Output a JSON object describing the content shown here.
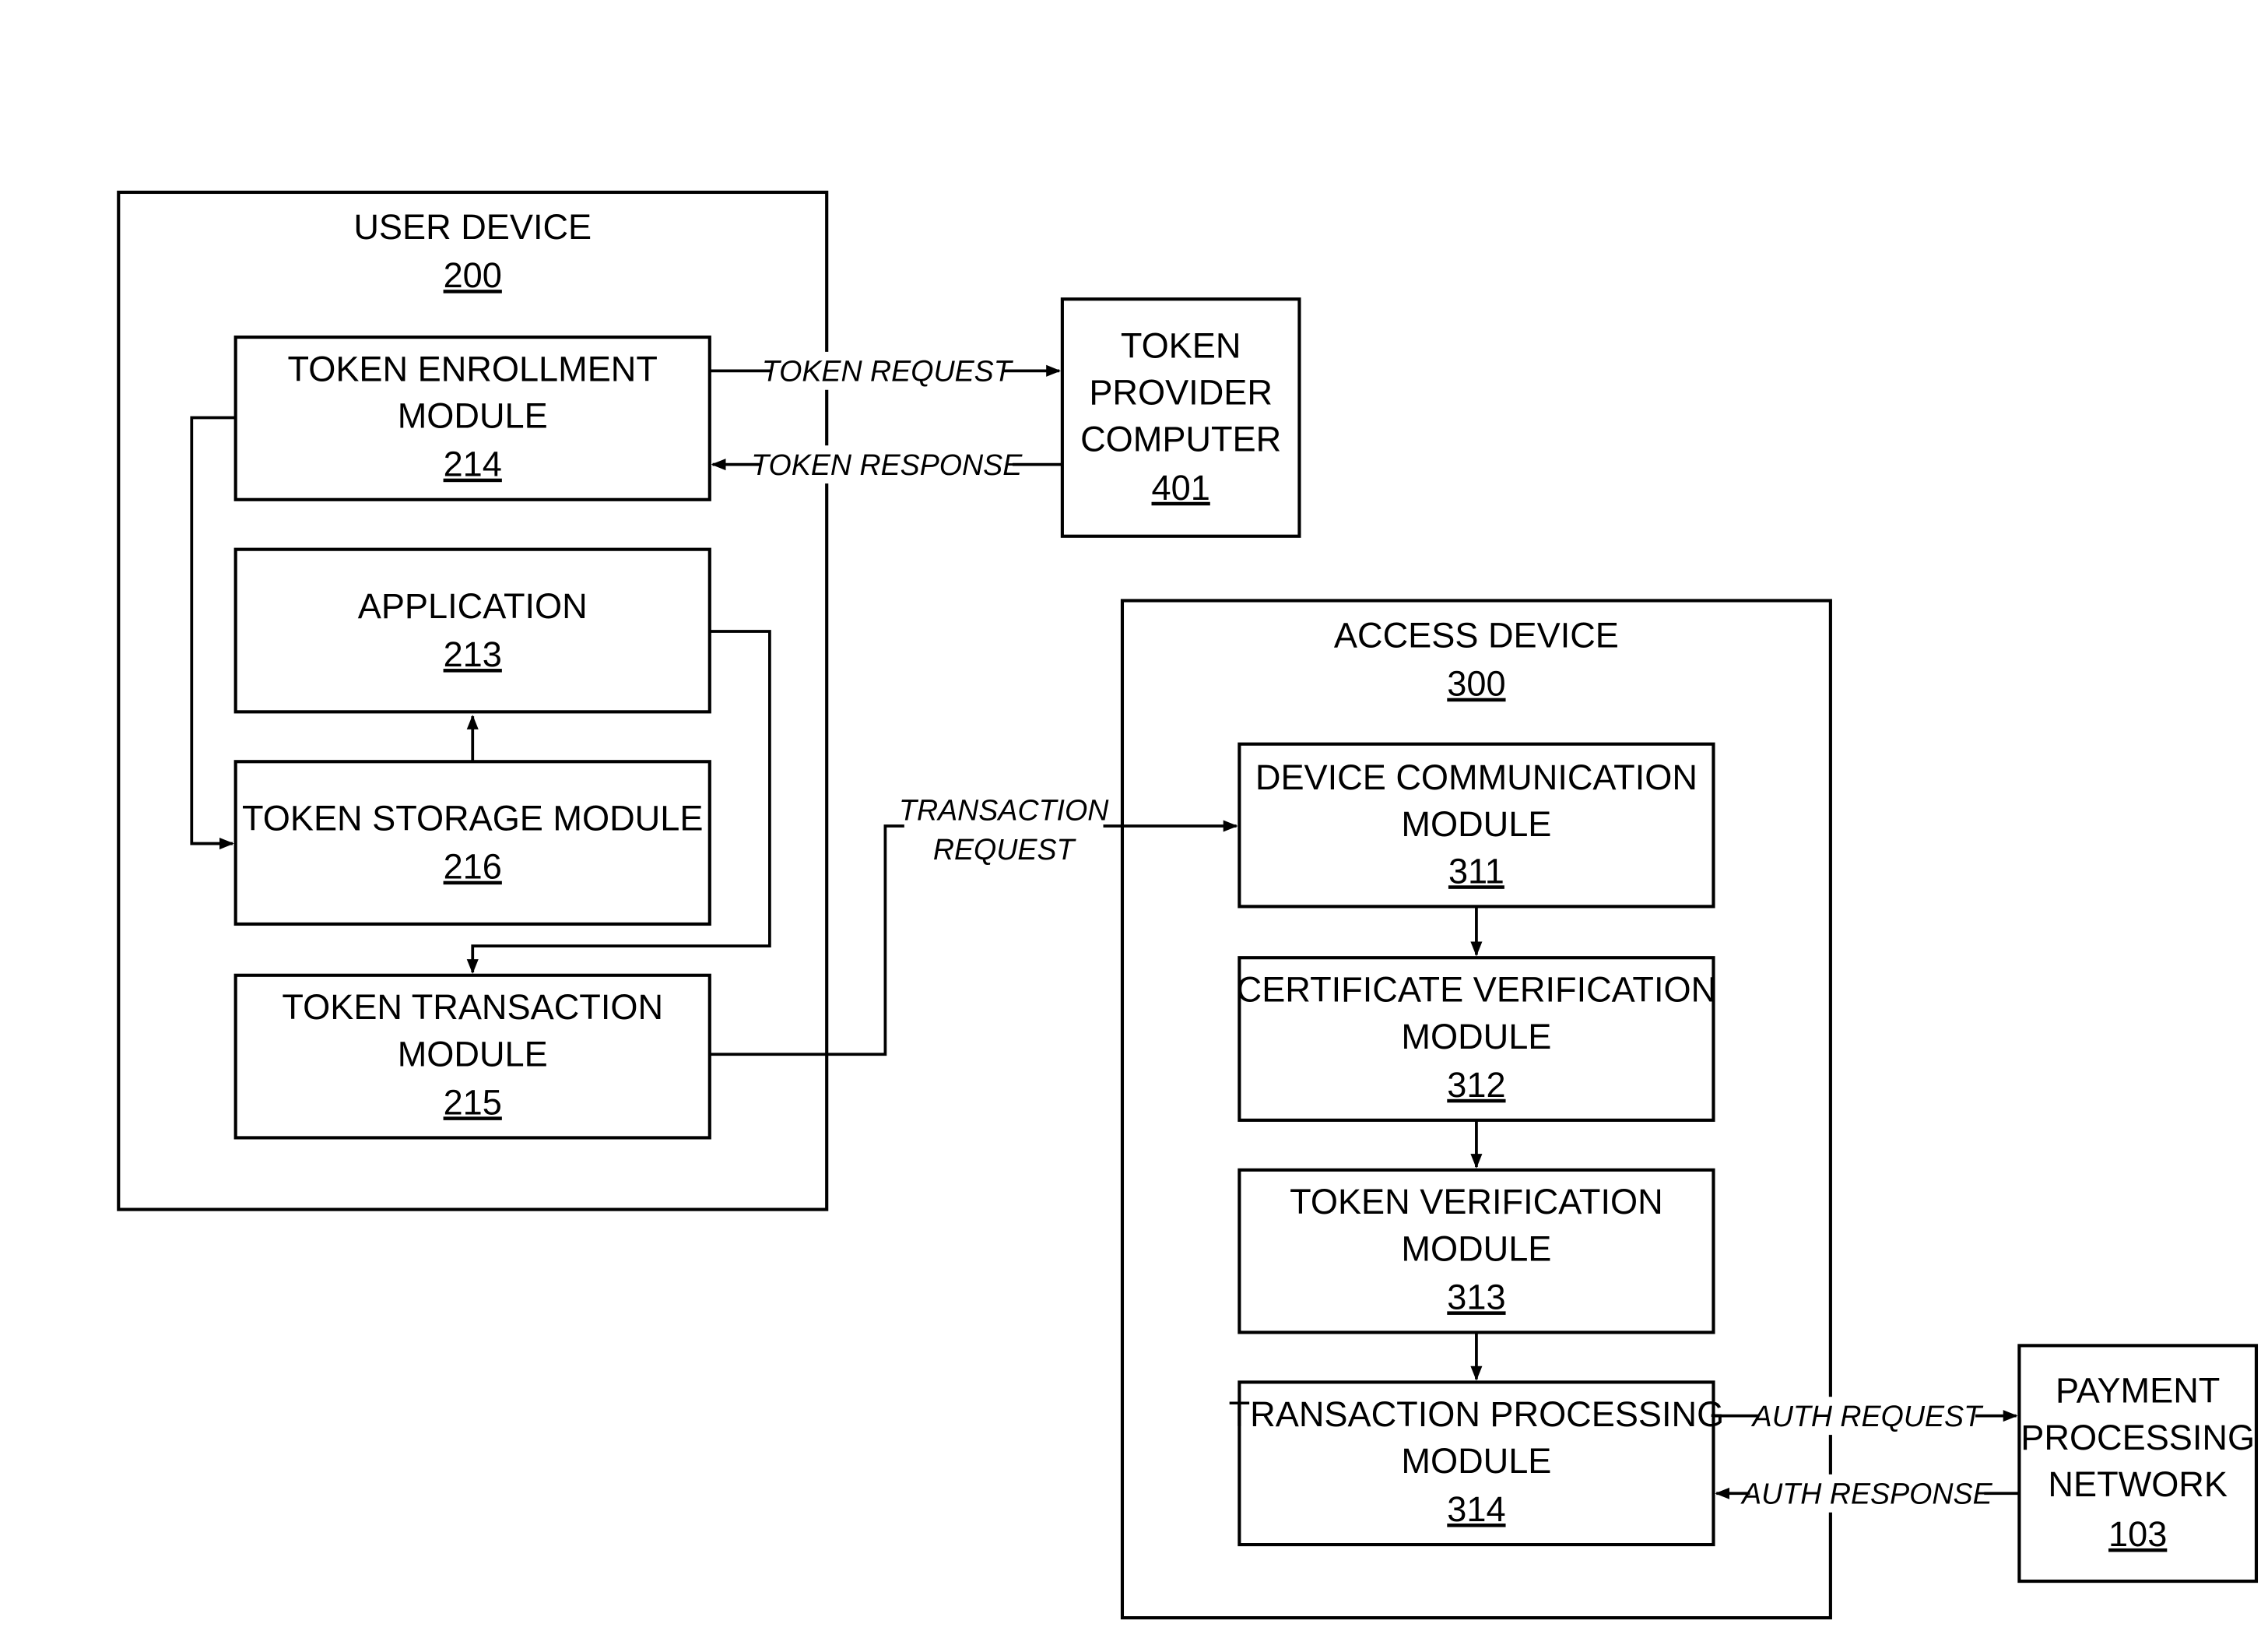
{
  "user_device": {
    "title": "USER  DEVICE",
    "ref": "200"
  },
  "token_enrollment": {
    "line1": "TOKEN ENROLLMENT",
    "line2": "MODULE",
    "ref": "214"
  },
  "application": {
    "line1": "APPLICATION",
    "ref": "213"
  },
  "token_storage": {
    "line1": "TOKEN STORAGE MODULE",
    "ref": "216"
  },
  "token_transaction": {
    "line1": "TOKEN TRANSACTION",
    "line2": "MODULE",
    "ref": "215"
  },
  "token_provider": {
    "line1": "TOKEN",
    "line2": "PROVIDER",
    "line3": "COMPUTER",
    "ref": "401"
  },
  "access_device": {
    "title": "ACCESS DEVICE",
    "ref": "300"
  },
  "device_comm": {
    "line1": "DEVICE COMMUNICATION",
    "line2": "MODULE",
    "ref": "311"
  },
  "cert_verif": {
    "line1": "CERTIFICATE VERIFICATION",
    "line2": "MODULE",
    "ref": "312"
  },
  "token_verif": {
    "line1": "TOKEN VERIFICATION",
    "line2": "MODULE",
    "ref": "313"
  },
  "txn_processing": {
    "line1": "TRANSACTION PROCESSING",
    "line2": "MODULE",
    "ref": "314"
  },
  "payment_network": {
    "line1": "PAYMENT",
    "line2": "PROCESSING",
    "line3": "NETWORK",
    "ref": "103"
  },
  "labels": {
    "token_request": "TOKEN REQUEST",
    "token_response": "TOKEN RESPONSE",
    "transaction_request_1": "TRANSACTION",
    "transaction_request_2": "REQUEST",
    "auth_request": "AUTH REQUEST",
    "auth_response": "AUTH RESPONSE"
  }
}
